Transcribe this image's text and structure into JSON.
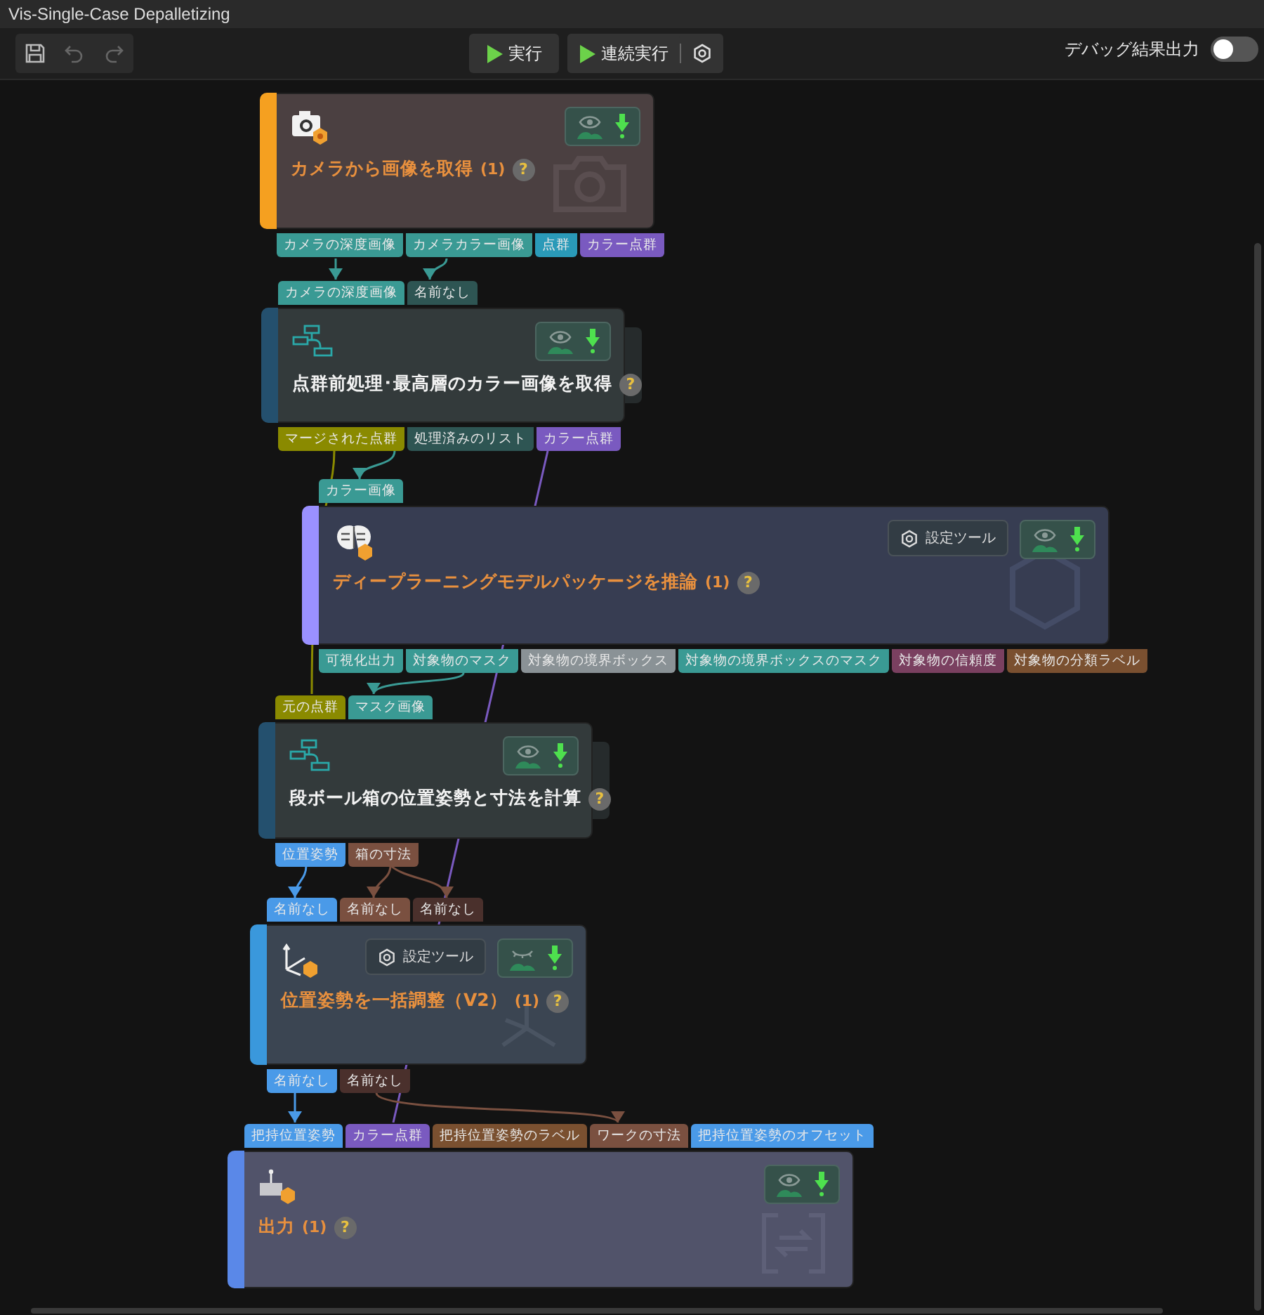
{
  "window": {
    "title": "Vis-Single-Case Depalletizing"
  },
  "toolbar": {
    "run_label": "実行",
    "continuous_run_label": "連続実行",
    "debug_label": "デバッグ結果出力",
    "debug_on": false
  },
  "nodes": [
    {
      "kind": "camera",
      "title": "カメラから画像を取得",
      "title_highlighted": true,
      "count": "(1)",
      "help": "?",
      "color": "#f5a020",
      "preview_visible": true,
      "outputs": [
        {
          "label": "カメラの深度画像",
          "color": "#3a9a94"
        },
        {
          "label": "カメラカラー画像",
          "color": "#3a9a94"
        },
        {
          "label": "点群",
          "color": "#2a9ab8"
        },
        {
          "label": "カラー点群",
          "color": "#7a5ac0"
        }
      ]
    },
    {
      "kind": "procedure",
      "title": "点群前処理･最高層のカラー画像を取得",
      "title_highlighted": false,
      "help": "?",
      "color": "#24506e",
      "preview_visible": true,
      "inputs": [
        {
          "label": "カメラの深度画像",
          "color": "#3a9a94"
        },
        {
          "label": "名前なし",
          "color": "#2e5553"
        }
      ],
      "outputs": [
        {
          "label": "マージされた点群",
          "color": "#8a8a00"
        },
        {
          "label": "処理済みのリスト",
          "color": "#2e5553"
        },
        {
          "label": "カラー点群",
          "color": "#7a5ac0"
        }
      ]
    },
    {
      "kind": "ai",
      "title": "ディープラーニングモデルパッケージを推論",
      "title_highlighted": true,
      "count": "(1)",
      "help": "?",
      "color": "#9a90ff",
      "settings": "設定ツール",
      "preview_visible": true,
      "inputs": [
        {
          "label": "カラー画像",
          "color": "#3a9a94"
        }
      ],
      "outputs": [
        {
          "label": "可視化出力",
          "color": "#3a9a94"
        },
        {
          "label": "対象物のマスク",
          "color": "#3a9a94"
        },
        {
          "label": "対象物の境界ボックス",
          "color": "#8a9296"
        },
        {
          "label": "対象物の境界ボックスのマスク",
          "color": "#3a9a94"
        },
        {
          "label": "対象物の信頼度",
          "color": "#7a4060"
        },
        {
          "label": "対象物の分類ラベル",
          "color": "#7a5030"
        }
      ]
    },
    {
      "kind": "procedure",
      "title": "段ボール箱の位置姿勢と寸法を計算",
      "title_highlighted": false,
      "help": "?",
      "color": "#24506e",
      "preview_visible": true,
      "inputs": [
        {
          "label": "元の点群",
          "color": "#8a8a00"
        },
        {
          "label": "マスク画像",
          "color": "#3a9a94"
        }
      ],
      "outputs": [
        {
          "label": "位置姿勢",
          "color": "#4a9ae8"
        },
        {
          "label": "箱の寸法",
          "color": "#7a5040"
        }
      ]
    },
    {
      "kind": "pose",
      "title": "位置姿勢を一括調整（V2）",
      "title_highlighted": true,
      "count": "(1)",
      "help": "?",
      "color": "#3a98dc",
      "settings": "設定ツール",
      "preview_visible": false,
      "inputs": [
        {
          "label": "名前なし",
          "color": "#4a9ae8"
        },
        {
          "label": "名前なし",
          "color": "#7a5040"
        },
        {
          "label": "名前なし",
          "color": "#4a302c"
        }
      ],
      "outputs": [
        {
          "label": "名前なし",
          "color": "#4a9ae8"
        },
        {
          "label": "名前なし",
          "color": "#4a302c"
        }
      ]
    },
    {
      "kind": "output",
      "title": "出力",
      "title_highlighted": true,
      "count": "(1)",
      "help": "?",
      "color": "#5a88e8",
      "preview_visible": true,
      "inputs": [
        {
          "label": "把持位置姿勢",
          "color": "#4a9ae8"
        },
        {
          "label": "カラー点群",
          "color": "#7a5ac0"
        },
        {
          "label": "把持位置姿勢のラベル",
          "color": "#7a5030"
        },
        {
          "label": "ワークの寸法",
          "color": "#7a5040"
        },
        {
          "label": "把持位置姿勢のオフセット",
          "color": "#4a9ae8"
        }
      ]
    }
  ]
}
